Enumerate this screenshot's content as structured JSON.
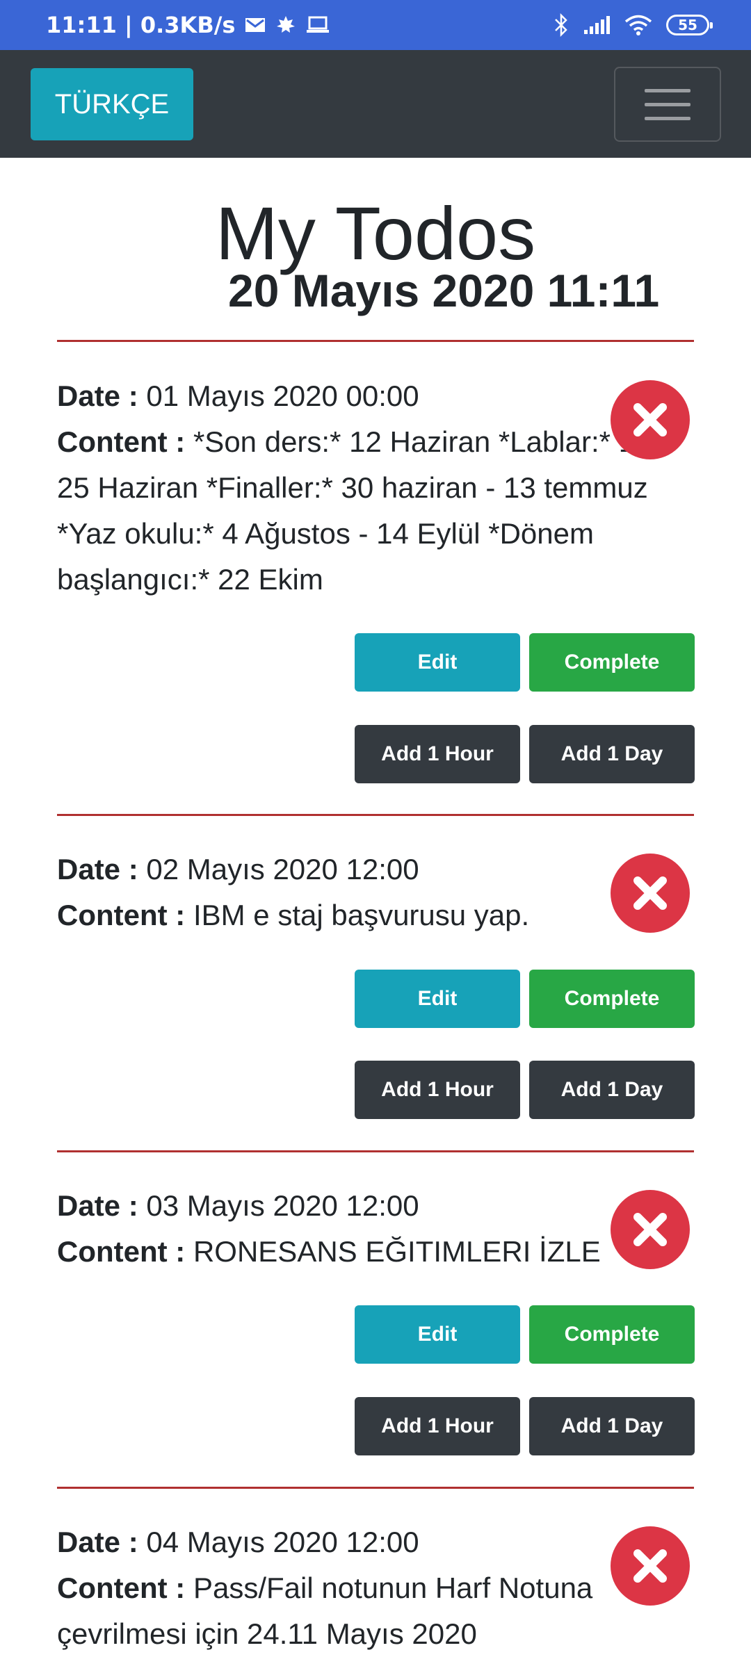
{
  "status_bar": {
    "time_speed": "11:11 | 0.3KB/s",
    "battery": "55"
  },
  "navbar": {
    "language_button": "TÜRKÇE"
  },
  "header": {
    "title": "My Todos",
    "datetime": "20 Mayıs 2020 11:11"
  },
  "labels": {
    "date": "Date :",
    "content": "Content :"
  },
  "buttons": {
    "edit": "Edit",
    "complete": "Complete",
    "add_hour": "Add 1 Hour",
    "add_day": "Add 1 Day"
  },
  "todos": [
    {
      "date": " 01 Mayıs 2020 00:00",
      "content": " *Son ders:* 12 Haziran *Lablar:* 15-25 Haziran *Finaller:* 30 haziran - 13 temmuz *Yaz okulu:* 4 Ağustos - 14 Eylül *Dönem başlangıcı:* 22 Ekim"
    },
    {
      "date": " 02 Mayıs 2020 12:00",
      "content": " IBM e staj başvurusu yap."
    },
    {
      "date": " 03 Mayıs 2020 12:00",
      "content": " RONESANS EĞITIMLERI İZLE"
    },
    {
      "date": " 04 Mayıs 2020 12:00",
      "content": " Pass/Fail notunun Harf Notuna çevrilmesi için 24.11 Mayıs 2020"
    }
  ],
  "colors": {
    "status_bar": "#3a66d6",
    "navbar": "#343a40",
    "info": "#17a2b8",
    "success": "#28a745",
    "danger": "#dc3545",
    "divider": "#b03030"
  }
}
